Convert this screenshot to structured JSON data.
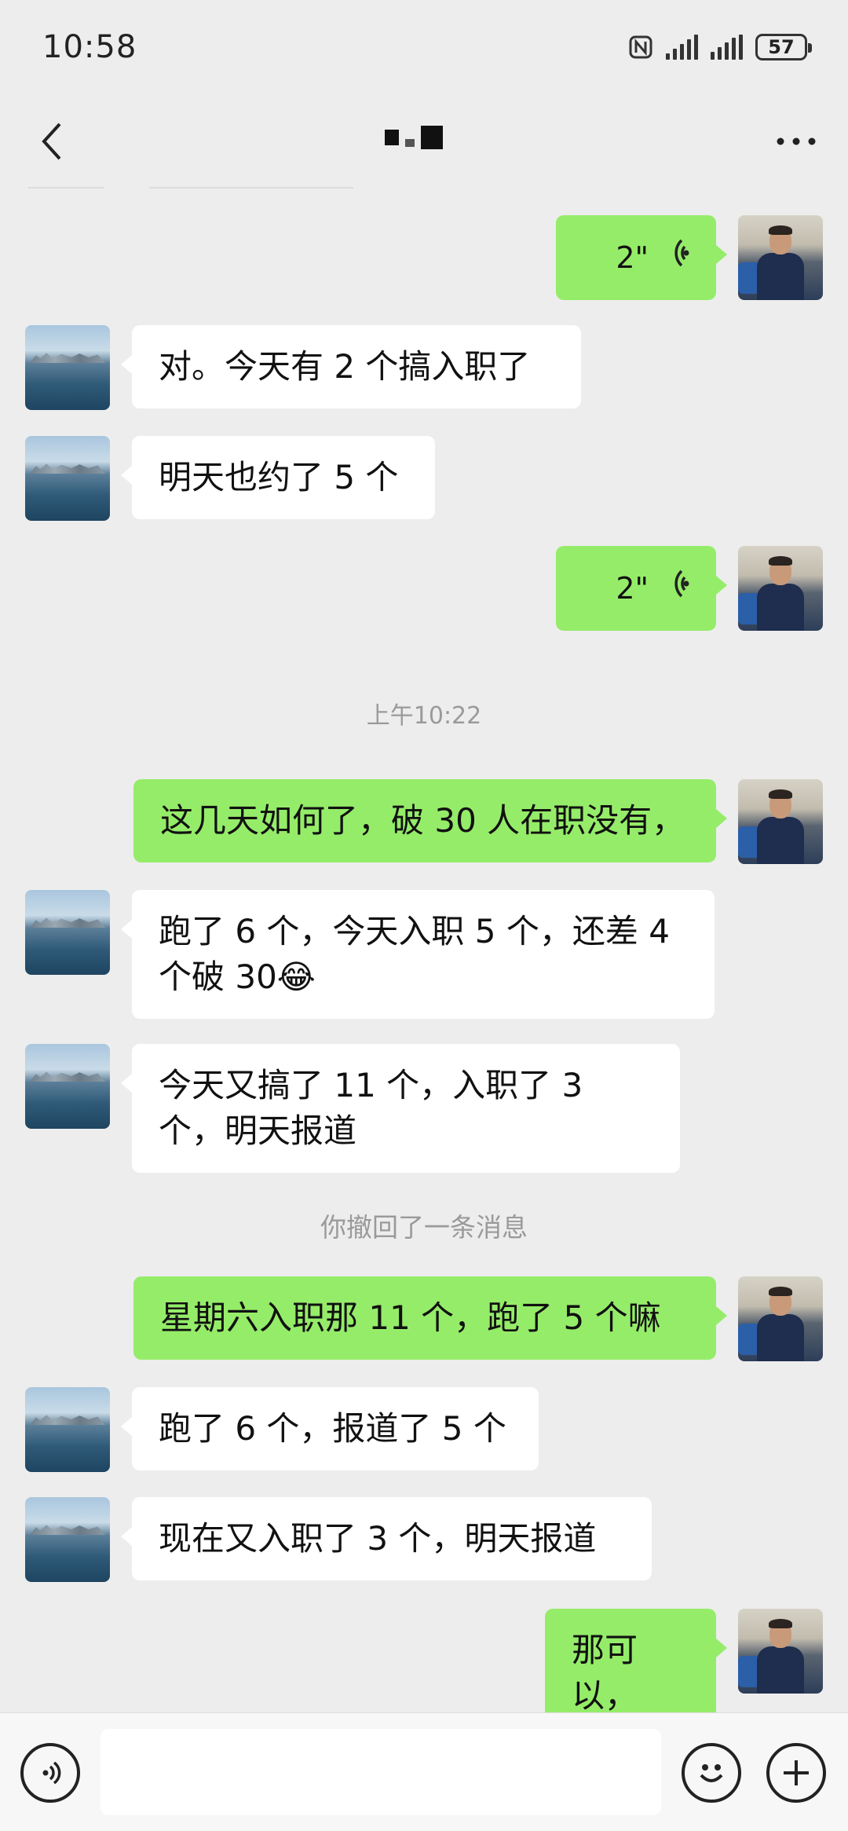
{
  "status_bar": {
    "time": "10:58",
    "battery": "57",
    "icons": [
      "nfc-icon",
      "signal-icon",
      "signal-icon",
      "battery-icon"
    ]
  },
  "header": {
    "back_icon": "chevron-left-icon",
    "more_icon": "more-dots-icon"
  },
  "messages": [
    {
      "side": "self",
      "type": "voice",
      "duration": "2\""
    },
    {
      "side": "other",
      "type": "text",
      "text": "对。今天有 2 个搞入职了"
    },
    {
      "side": "other",
      "type": "text",
      "text": "明天也约了 5 个"
    },
    {
      "side": "self",
      "type": "voice",
      "duration": "2\""
    },
    {
      "side": "system",
      "type": "timestamp",
      "text": "上午10:22"
    },
    {
      "side": "self",
      "type": "text",
      "text": "这几天如何了，破 30 人在职没有，"
    },
    {
      "side": "other",
      "type": "text",
      "text": "跑了 6 个，今天入职 5 个，还差 4 个破 30😂"
    },
    {
      "side": "other",
      "type": "text",
      "text": "今天又搞了 11 个，入职了 3 个，明天报道"
    },
    {
      "side": "system",
      "type": "notice",
      "text": "你撤回了一条消息"
    },
    {
      "side": "self",
      "type": "text",
      "text": "星期六入职那 11 个，跑了 5 个嘛"
    },
    {
      "side": "other",
      "type": "text",
      "text": "跑了 6 个，报道了 5 个"
    },
    {
      "side": "other",
      "type": "text",
      "text": "现在又入职了 3 个，明天报道"
    },
    {
      "side": "self",
      "type": "text",
      "text": "那可以，"
    }
  ],
  "input_bar": {
    "voice_icon": "voice-input-icon",
    "emoji_icon": "emoji-icon",
    "plus_icon": "plus-icon",
    "text_value": ""
  },
  "colors": {
    "self_bubble": "#95ec69",
    "other_bubble": "#ffffff",
    "background": "#ededed"
  }
}
